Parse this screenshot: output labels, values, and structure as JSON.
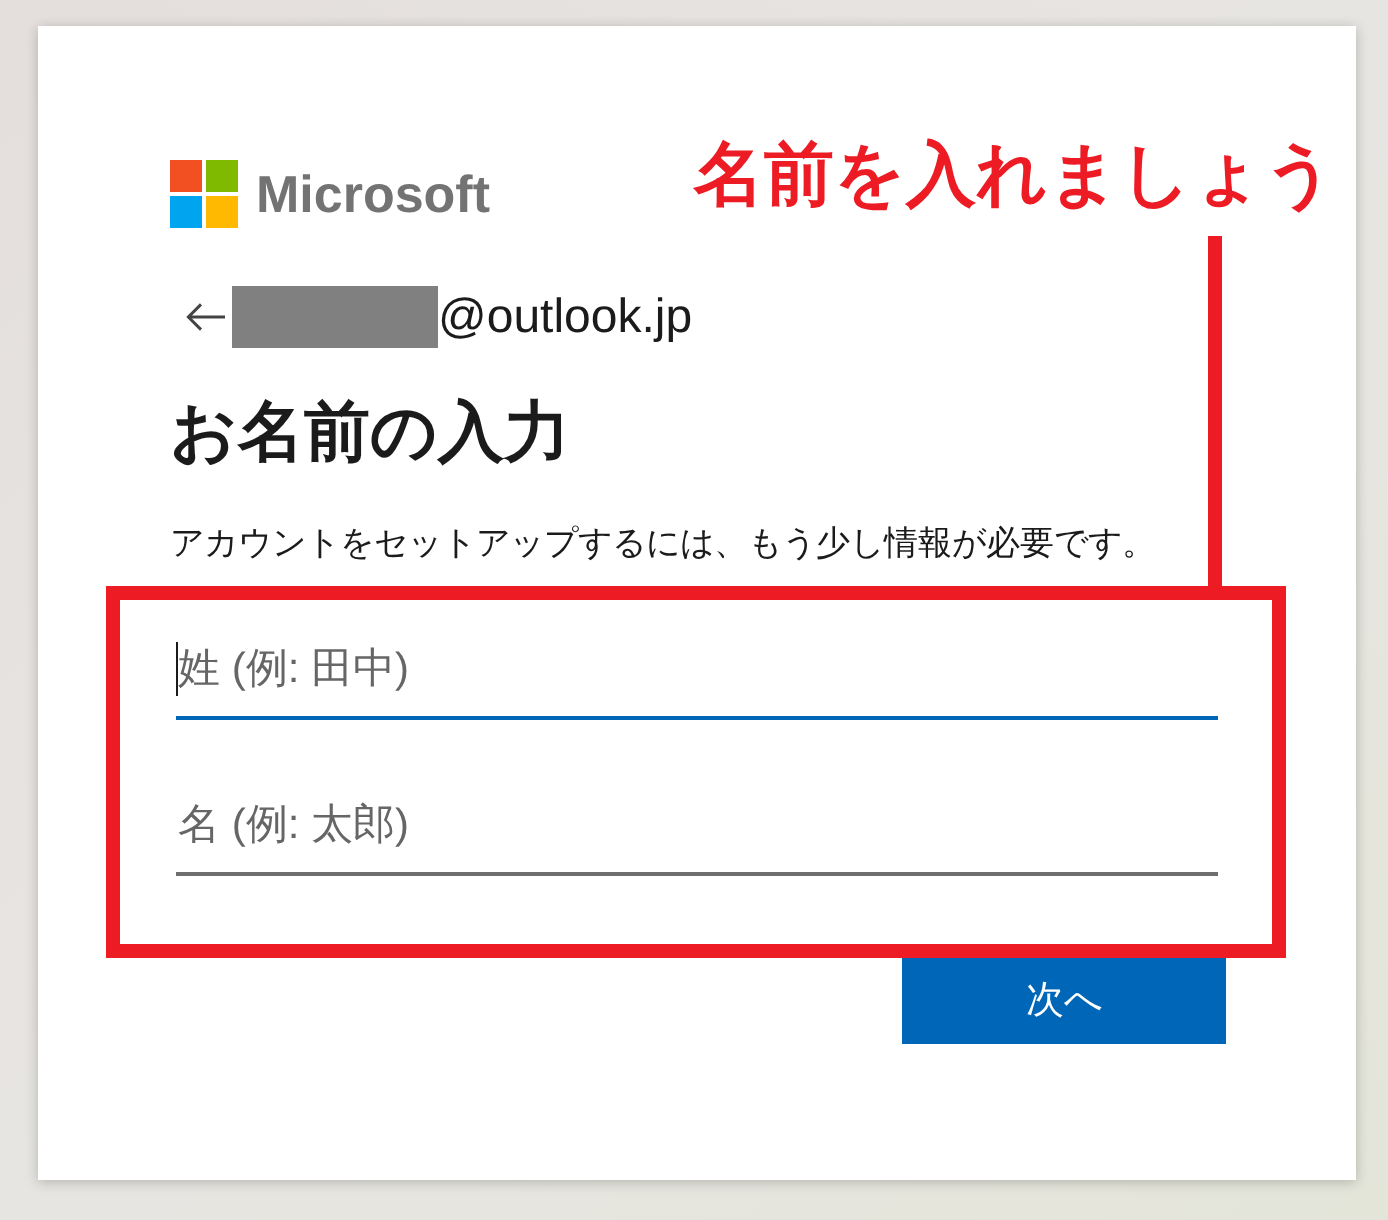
{
  "logo": {
    "text": "Microsoft"
  },
  "account": {
    "redacted": true,
    "email_suffix": "@outlook.jp"
  },
  "heading": "お名前の入力",
  "description": "アカウントをセットアップするには、もう少し情報が必要です。",
  "fields": [
    {
      "placeholder": "姓 (例: 田中)",
      "focused": true
    },
    {
      "placeholder": "名 (例: 太郎)",
      "focused": false
    }
  ],
  "next_button": {
    "label": "次へ"
  },
  "annotation": {
    "text": "名前を入れましょう"
  }
}
